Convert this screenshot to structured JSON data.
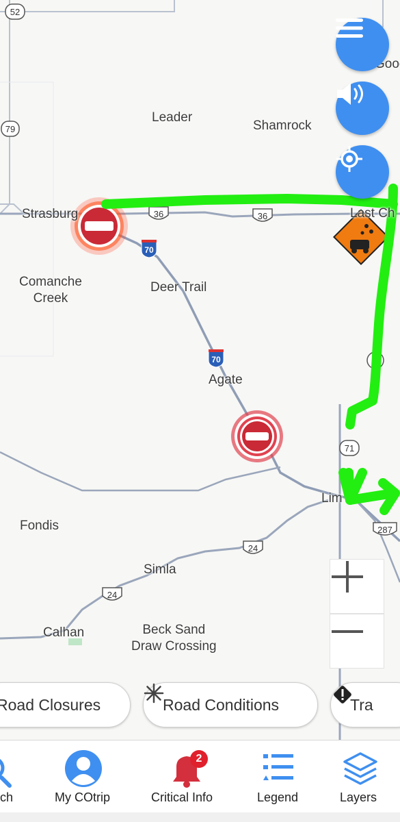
{
  "map": {
    "places": [
      {
        "name": "Leader"
      },
      {
        "name": "Shamrock"
      },
      {
        "name": "Strasburg"
      },
      {
        "name": "Comanche\nCreek"
      },
      {
        "name": "Deer Trail"
      },
      {
        "name": "Agate"
      },
      {
        "name": "Fondis"
      },
      {
        "name": "Simla"
      },
      {
        "name": "Calhan"
      },
      {
        "name": "Beck Sand\nDraw Crossing"
      },
      {
        "name": "Goodrc"
      },
      {
        "name": "Last Ch"
      },
      {
        "name": "Lim"
      }
    ],
    "shields": [
      "52",
      "79",
      "36",
      "36",
      "70",
      "70",
      "71",
      "24",
      "24",
      "287"
    ],
    "markers": [
      "road-closure",
      "road-closure",
      "rockfall-warning"
    ]
  },
  "controls": {
    "menu_icon": "hamburger-icon",
    "sound_icon": "speaker-icon",
    "locate_icon": "crosshair-icon",
    "zoom_in": "+",
    "zoom_out": "−"
  },
  "chips": [
    {
      "label": "Road Closures",
      "icon": "no-entry-icon"
    },
    {
      "label": "Road Conditions",
      "icon": "snowflake-icon"
    },
    {
      "label": "Tra",
      "icon": "warning-icon"
    }
  ],
  "nav": {
    "items": [
      {
        "label": "ch",
        "icon": "search-icon"
      },
      {
        "label": "My COtrip",
        "icon": "user-icon"
      },
      {
        "label": "Critical Info",
        "icon": "bell-icon",
        "badge": "2"
      },
      {
        "label": "Legend",
        "icon": "list-icon"
      },
      {
        "label": "Layers",
        "icon": "layers-icon"
      }
    ]
  },
  "colors": {
    "accent": "#3f8ff0",
    "closure": "#d32f3c",
    "annotation": "#22ee11",
    "warning": "#f07b10"
  }
}
